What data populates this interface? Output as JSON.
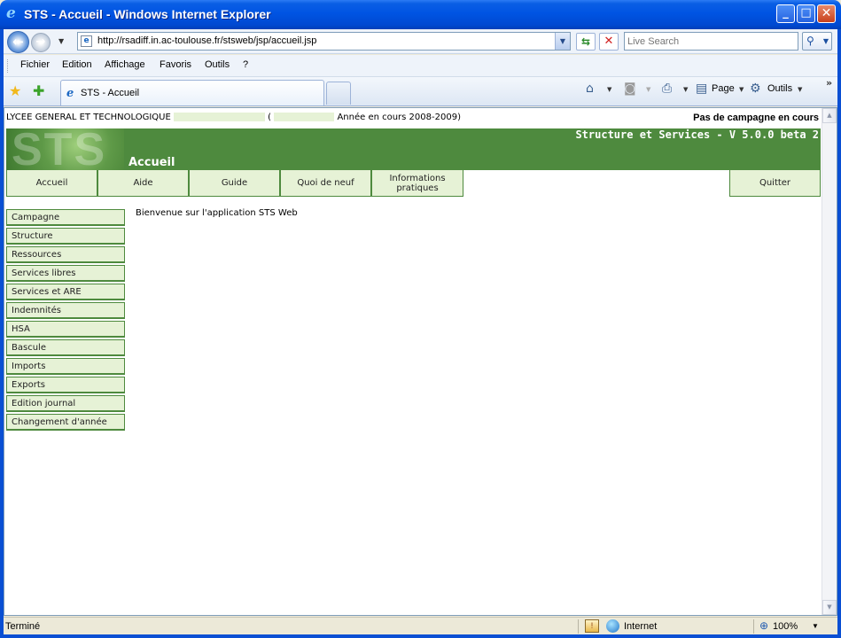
{
  "window": {
    "title": "STS - Accueil - Windows Internet Explorer",
    "min_glyph": "_",
    "max_glyph": "□",
    "close_glyph": "✕"
  },
  "addressbar": {
    "url": "http://rsadiff.in.ac-toulouse.fr/stsweb/jsp/accueil.jsp",
    "search_placeholder": "Live Search"
  },
  "menu": {
    "items": [
      "Fichier",
      "Edition",
      "Affichage",
      "Favoris",
      "Outils",
      "?"
    ]
  },
  "tabs": {
    "active_label": "STS - Accueil"
  },
  "commandbar": {
    "page_label": "Page",
    "tools_label": "Outils"
  },
  "page": {
    "school_prefix": "LYCEE GENERAL ET TECHNOLOGIQUE",
    "open_paren": "(",
    "year_text": "Année en cours 2008-2009)",
    "campaign_status": "Pas de campagne en cours",
    "logo_text": "STS",
    "page_name": "Accueil",
    "version": "Structure et Services - V 5.0.0 beta 2",
    "topnav": {
      "home": "Accueil",
      "help": "Aide",
      "guide": "Guide",
      "whats_new": "Quoi de neuf",
      "info_line1": "Informations",
      "info_line2": "pratiques",
      "quit": "Quitter"
    },
    "sidemenu": [
      "Campagne",
      "Structure",
      "Ressources",
      "Services libres",
      "Services et ARE",
      "Indemnités",
      "HSA",
      "Bascule",
      "Imports",
      "Exports",
      "Edition journal",
      "Changement d'année"
    ],
    "welcome": "Bienvenue sur l'application STS Web"
  },
  "statusbar": {
    "status": "Terminé",
    "zone": "Internet",
    "zoom": "100%"
  },
  "colors": {
    "banner_green": "#4e8a3e",
    "nav_bg": "#e6f2d6",
    "xp_blue": "#0054e3"
  }
}
